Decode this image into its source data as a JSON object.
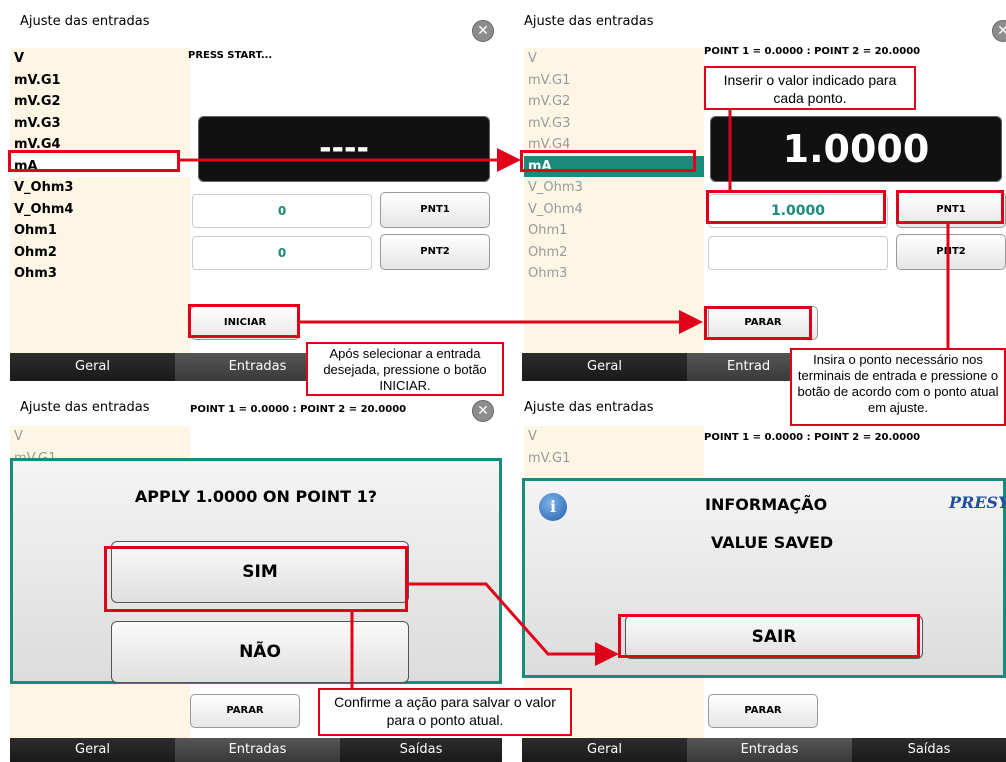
{
  "panel_title": "Ajuste das entradas",
  "tabs": [
    "Geral",
    "Entradas",
    "Saídas"
  ],
  "tab_trunc": "Entrad",
  "list_items": [
    "V",
    "mV.G1",
    "mV.G2",
    "mV.G3",
    "mV.G4",
    "mA",
    "V_Ohm3",
    "V_Ohm4",
    "Ohm1",
    "Ohm2",
    "Ohm3"
  ],
  "p1": {
    "status": "PRESS START...",
    "display": "----",
    "pnt1_value": "0",
    "pnt2_value": "0",
    "pnt1": "PNT1",
    "pnt2": "PNT2",
    "start": "INICIAR"
  },
  "p2": {
    "status": "POINT 1 = 0.0000 : POINT 2 = 20.0000",
    "display": "1.0000",
    "pnt1_value": "1.0000",
    "pnt2_value": "",
    "pnt1": "PNT1",
    "pnt2": "PNT2",
    "stop": "PARAR"
  },
  "p3": {
    "status": "POINT 1 = 0.0000 : POINT 2 = 20.0000",
    "question": "APPLY 1.0000 ON POINT 1?",
    "yes": "SIM",
    "no": "NÃO",
    "stop": "PARAR"
  },
  "p4": {
    "status": "POINT 1 = 0.0000 : POINT 2 = 20.0000",
    "dialog_title": "INFORMAÇÃO",
    "message": "VALUE SAVED",
    "brand": "PRESYS",
    "exit": "SAIR",
    "stop": "PARAR"
  },
  "callouts": {
    "c1": "Após selecionar a entrada desejada, pressione o botão INICIAR.",
    "c2": "Inserir o valor indicado para cada ponto.",
    "c3": "Insira o ponto necessário nos terminais de entrada e pressione o botão de acordo com o ponto atual em ajuste.",
    "c4": "Confirme a ação para salvar o valor para o ponto atual."
  },
  "colors": {
    "accent": "#1b8a7d",
    "highlight": "#e1001a",
    "list_bg": "#fdf6e4"
  }
}
